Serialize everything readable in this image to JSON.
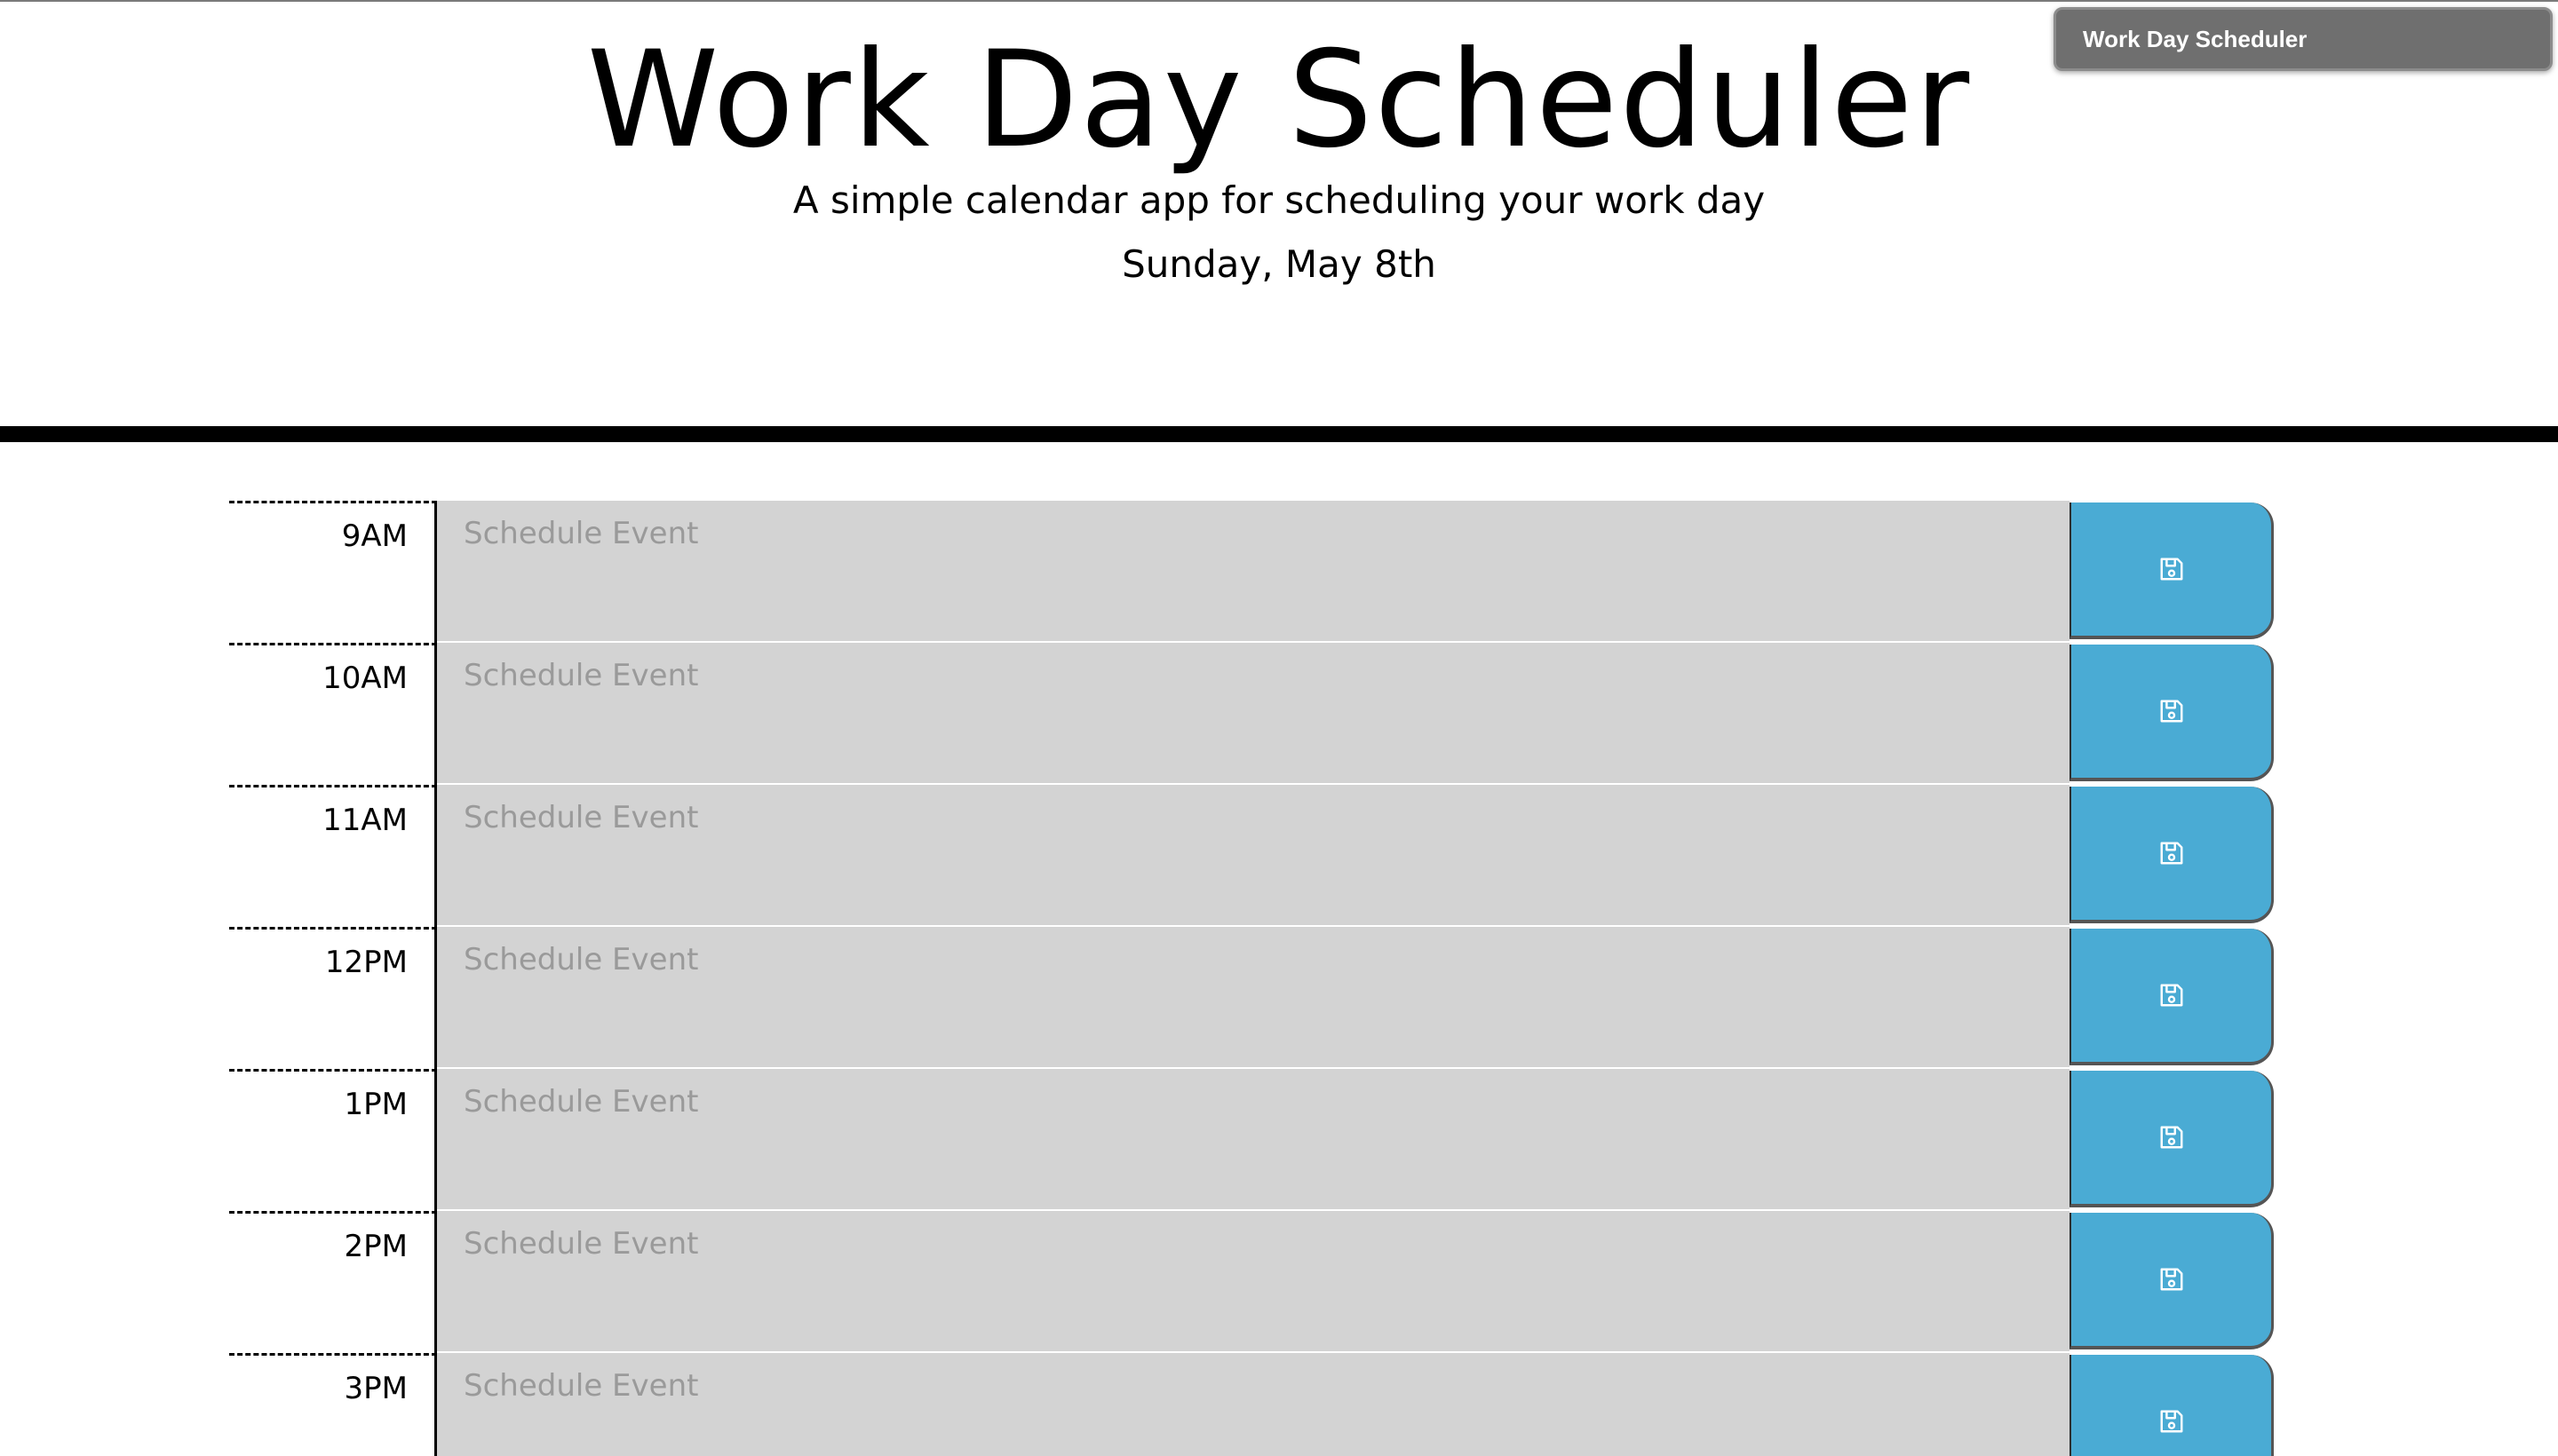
{
  "window": {
    "tab_title": "Work Day Scheduler"
  },
  "header": {
    "title": "Work Day Scheduler",
    "lead": "A simple calendar app for scheduling your work day",
    "current_day": "Sunday, May 8th"
  },
  "schedule": {
    "placeholder": "Schedule Event",
    "save_icon": "floppy-disk-icon",
    "hours": [
      {
        "label": "9AM",
        "value": ""
      },
      {
        "label": "10AM",
        "value": ""
      },
      {
        "label": "11AM",
        "value": ""
      },
      {
        "label": "12PM",
        "value": ""
      },
      {
        "label": "1PM",
        "value": ""
      },
      {
        "label": "2PM",
        "value": ""
      },
      {
        "label": "3PM",
        "value": ""
      }
    ]
  },
  "colors": {
    "textarea_bg": "#d3d3d3",
    "save_button": "#4aabd4",
    "divider": "#000000"
  }
}
